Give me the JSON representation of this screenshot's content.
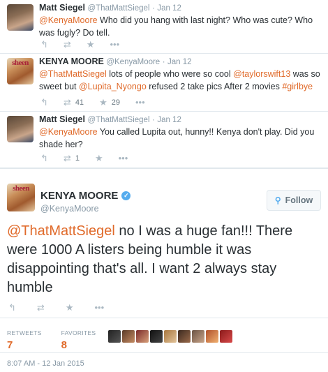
{
  "feed": [
    {
      "name": "Matt Siegel",
      "handle": "@ThatMattSiegel",
      "dot": "·",
      "date": "Jan 12",
      "mention": "@KenyaMoore",
      "text": " Who did you hang with last night? Who was cute? Who was fugly? Do tell.",
      "retweets": "",
      "favorites": ""
    },
    {
      "name": "KENYA MOORE",
      "handle": "@KenyaMoore",
      "dot": "·",
      "date": "Jan 12",
      "mention1": "@ThatMattSiegel",
      "text1": " lots of people who were so cool ",
      "mention2": "@taylorswift13",
      "text2": " was so sweet but ",
      "mention3": "@Lupita_Nyongo",
      "text3": " refused 2 take pics After 2 movies ",
      "hashtag": "#girlbye",
      "retweets": "41",
      "favorites": "29"
    },
    {
      "name": "Matt Siegel",
      "handle": "@ThatMattSiegel",
      "dot": "·",
      "date": "Jan 12",
      "mention": "@KenyaMoore",
      "text": " You called Lupita out, hunny!! Kenya don't play. Did you shade her?",
      "retweets": "1",
      "favorites": ""
    }
  ],
  "main": {
    "name": "KENYA MOORE",
    "handle": "@KenyaMoore",
    "follow_label": "Follow",
    "mention": "@ThatMattSiegel",
    "text": " no I was a huge fan!!! There were 1000 A listers being humble it was disappointing that's all. I want 2 always stay humble",
    "retweets_label": "RETWEETS",
    "retweets_value": "7",
    "favorites_label": "FAVORITES",
    "favorites_value": "8",
    "timestamp": "8:07 AM - 12 Jan 2015"
  },
  "icons": {
    "reply": "reply-icon",
    "retweet": "retweet-icon",
    "favorite": "star-icon",
    "more": "more-icon",
    "verified": "verified-badge-icon",
    "follow": "add-user-icon"
  },
  "colors": {
    "link": "#e06a2a",
    "verified": "#55acee",
    "muted": "#8899a6"
  }
}
